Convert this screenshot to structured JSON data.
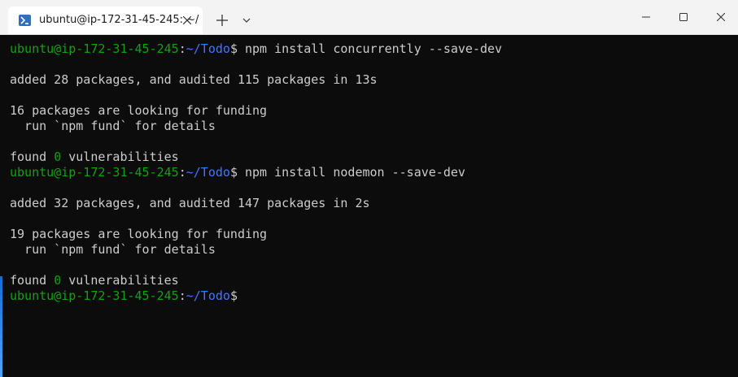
{
  "window": {
    "tab_title": "ubuntu@ip-172-31-45-245: ~/",
    "icons": {
      "tab": "powershell-icon",
      "tab_close": "close-icon",
      "new_tab": "plus-icon",
      "dropdown": "chevron-down-icon",
      "minimize": "minimize-icon",
      "maximize": "maximize-icon",
      "close": "close-icon"
    }
  },
  "colors": {
    "user_host": "#13a10e",
    "path": "#3b78ff",
    "text": "#cccccc",
    "background": "#0c0c0c"
  },
  "terminal": {
    "prompt": {
      "user_host": "ubuntu@ip-172-31-45-245",
      "sep": ":",
      "path": "~/Todo",
      "dollar": "$"
    },
    "cmd1": " npm install concurrently --save-dev",
    "out1": "added 28 packages, and audited 115 packages in 13s",
    "out2": "16 packages are looking for funding",
    "out3": "  run `npm fund` for details",
    "out4_pre": "found ",
    "out4_num": "0",
    "out4_post": " vulnerabilities",
    "cmd2": " npm install nodemon --save-dev",
    "out5": "added 32 packages, and audited 147 packages in 2s",
    "out6": "19 packages are looking for funding",
    "out7": "  run `npm fund` for details",
    "out8_pre": "found ",
    "out8_num": "0",
    "out8_post": " vulnerabilities"
  }
}
